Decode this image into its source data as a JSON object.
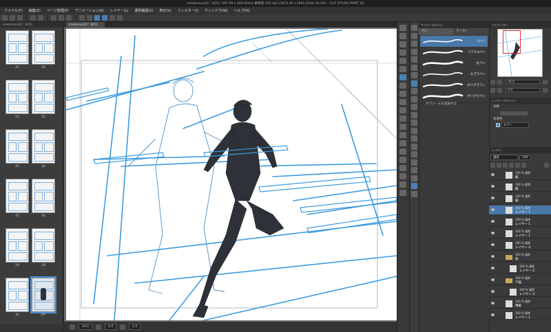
{
  "window": {
    "title": "smallersoul31* .8252 (397.69 x 600.00mm 解像度 350 dpi) (3873.40 x 4665.45dpi 16.4%) - CLIP STUDIO PAINT EX"
  },
  "menu": [
    "ファイル(F)",
    "編集(E)",
    "ページ管理(P)",
    "アニメーション(A)",
    "レイヤー(L)",
    "選択範囲(S)",
    "表示(V)",
    "フィルター(I)",
    "ウィンドウ(W)",
    "ヘルプ(H)"
  ],
  "document": {
    "tab_label": "smallersoul31* .8252"
  },
  "pages": [
    {
      "left": "21",
      "right": "20"
    },
    {
      "left": "23",
      "right": "22"
    },
    {
      "left": "25",
      "right": "24"
    },
    {
      "left": "27",
      "right": "26"
    },
    {
      "left": "29",
      "right": "28"
    },
    {
      "left": "31",
      "right": "30*"
    }
  ],
  "status": {
    "zoom": "16.0",
    "angle": "0.0",
    "coords": "2.0"
  },
  "subtool": {
    "group_tabs": [
      "サブツール[ペン]",
      "",
      ""
    ],
    "tabs": [
      "ペン",
      "マーカー"
    ],
    "brushes": [
      "Gペン",
      "リアルGペン",
      "丸ペン",
      "カブラペン",
      "カリグラフィ",
      "カリグラペン"
    ],
    "selected_index": 0,
    "add_label": "サブツールを追加する"
  },
  "navigator": {
    "tab": "ナビゲーター",
    "zoom": "16.0",
    "angle": "0.0"
  },
  "properties": {
    "tab": "レイヤープロパティ",
    "effect_label": "効果",
    "color_label": "表現色",
    "color_value": "カラー"
  },
  "layers": {
    "tab": "レイヤー",
    "blend_mode": "通常",
    "opacity": "100",
    "rows": [
      {
        "l1": "100 % 通常",
        "l2": "紙",
        "type": "raster",
        "selected": false,
        "indent": false
      },
      {
        "l1": "100 % 通常",
        "l2": "紙",
        "type": "raster",
        "selected": false,
        "indent": false
      },
      {
        "l1": "100 % 通常",
        "l2": "紙",
        "type": "raster",
        "selected": false,
        "indent": false
      },
      {
        "l1": "100 % 通常",
        "l2": "レイヤー 7",
        "type": "raster",
        "selected": true,
        "indent": false
      },
      {
        "l1": "100 % 通常",
        "l2": "レイヤー 1",
        "type": "raster",
        "selected": false,
        "indent": false
      },
      {
        "l1": "100 % 通常",
        "l2": "レイヤー 1",
        "type": "raster",
        "selected": false,
        "indent": false
      },
      {
        "l1": "100 % 通常",
        "l2": "レイヤー 4",
        "type": "raster",
        "selected": false,
        "indent": false
      },
      {
        "l1": "100 % 通常",
        "l2": "枠",
        "type": "folder",
        "selected": false,
        "indent": false
      },
      {
        "l1": "100 % 通常",
        "l2": "レイヤー 2",
        "type": "raster",
        "selected": false,
        "indent": true
      },
      {
        "l1": "100 % 通常",
        "l2": "下描",
        "type": "folder",
        "selected": false,
        "indent": false
      },
      {
        "l1": "100 % 通常",
        "l2": "レイヤー 3",
        "type": "raster",
        "selected": false,
        "indent": true
      },
      {
        "l1": "100 % 通常",
        "l2": "用紙",
        "type": "raster",
        "selected": false,
        "indent": false
      },
      {
        "l1": "100 % 通常",
        "l2": "レイヤー 1",
        "type": "raster",
        "selected": false,
        "indent": false
      }
    ]
  },
  "colors": {
    "accent": "#4a90d9",
    "sketch_blue": "#3b9be0",
    "selection": "#4a78a8"
  }
}
